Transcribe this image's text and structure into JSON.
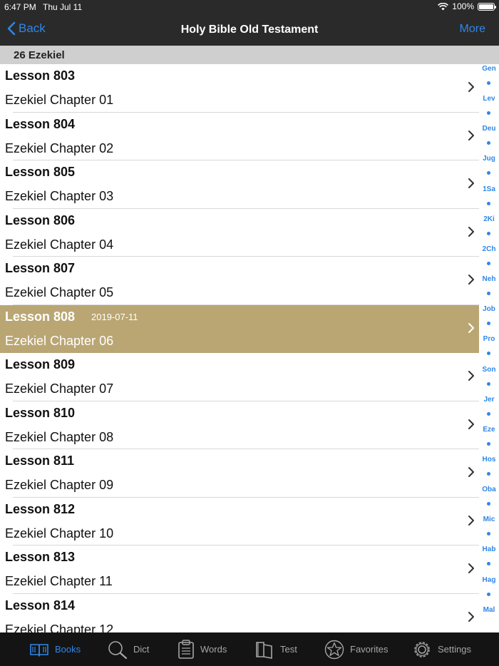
{
  "status": {
    "time": "6:47 PM",
    "date": "Thu Jul 11",
    "battery": "100%",
    "battery_level": 1.0
  },
  "nav": {
    "back_label": "Back",
    "title": "Holy Bible Old Testament",
    "more_label": "More"
  },
  "section": {
    "title": "26 Ezekiel"
  },
  "rows": [
    {
      "lesson": "Lesson 803",
      "chapter": "Ezekiel Chapter 01",
      "date": ""
    },
    {
      "lesson": "Lesson 804",
      "chapter": "Ezekiel Chapter 02",
      "date": ""
    },
    {
      "lesson": "Lesson 805",
      "chapter": "Ezekiel Chapter 03",
      "date": ""
    },
    {
      "lesson": "Lesson 806",
      "chapter": "Ezekiel Chapter 04",
      "date": ""
    },
    {
      "lesson": "Lesson 807",
      "chapter": "Ezekiel Chapter 05",
      "date": ""
    },
    {
      "lesson": "Lesson 808",
      "chapter": "Ezekiel Chapter 06",
      "date": "2019-07-11",
      "selected": true
    },
    {
      "lesson": "Lesson 809",
      "chapter": "Ezekiel Chapter 07",
      "date": ""
    },
    {
      "lesson": "Lesson 810",
      "chapter": "Ezekiel Chapter 08",
      "date": ""
    },
    {
      "lesson": "Lesson 811",
      "chapter": "Ezekiel Chapter 09",
      "date": ""
    },
    {
      "lesson": "Lesson 812",
      "chapter": "Ezekiel Chapter 10",
      "date": ""
    },
    {
      "lesson": "Lesson 813",
      "chapter": "Ezekiel Chapter 11",
      "date": ""
    },
    {
      "lesson": "Lesson 814",
      "chapter": "Ezekiel Chapter 12",
      "date": ""
    }
  ],
  "index": [
    "Gen",
    "Lev",
    "Deu",
    "Jug",
    "1Sa",
    "2Ki",
    "2Ch",
    "Neh",
    "Job",
    "Pro",
    "Son",
    "Jer",
    "Eze",
    "Hos",
    "Oba",
    "Mic",
    "Hab",
    "Hag",
    "Mal"
  ],
  "tabs": [
    {
      "label": "Books",
      "icon": "book-icon",
      "active": true
    },
    {
      "label": "Dict",
      "icon": "magnifier-icon"
    },
    {
      "label": "Words",
      "icon": "clipboard-icon"
    },
    {
      "label": "Test",
      "icon": "test-book-icon"
    },
    {
      "label": "Favorites",
      "icon": "star-icon"
    },
    {
      "label": "Settings",
      "icon": "gear-icon"
    }
  ],
  "colors": {
    "accent": "#2f86e8",
    "selected_row": "#baa673",
    "bar_background": "#2a2a2a",
    "tabbar_background": "#141414"
  }
}
